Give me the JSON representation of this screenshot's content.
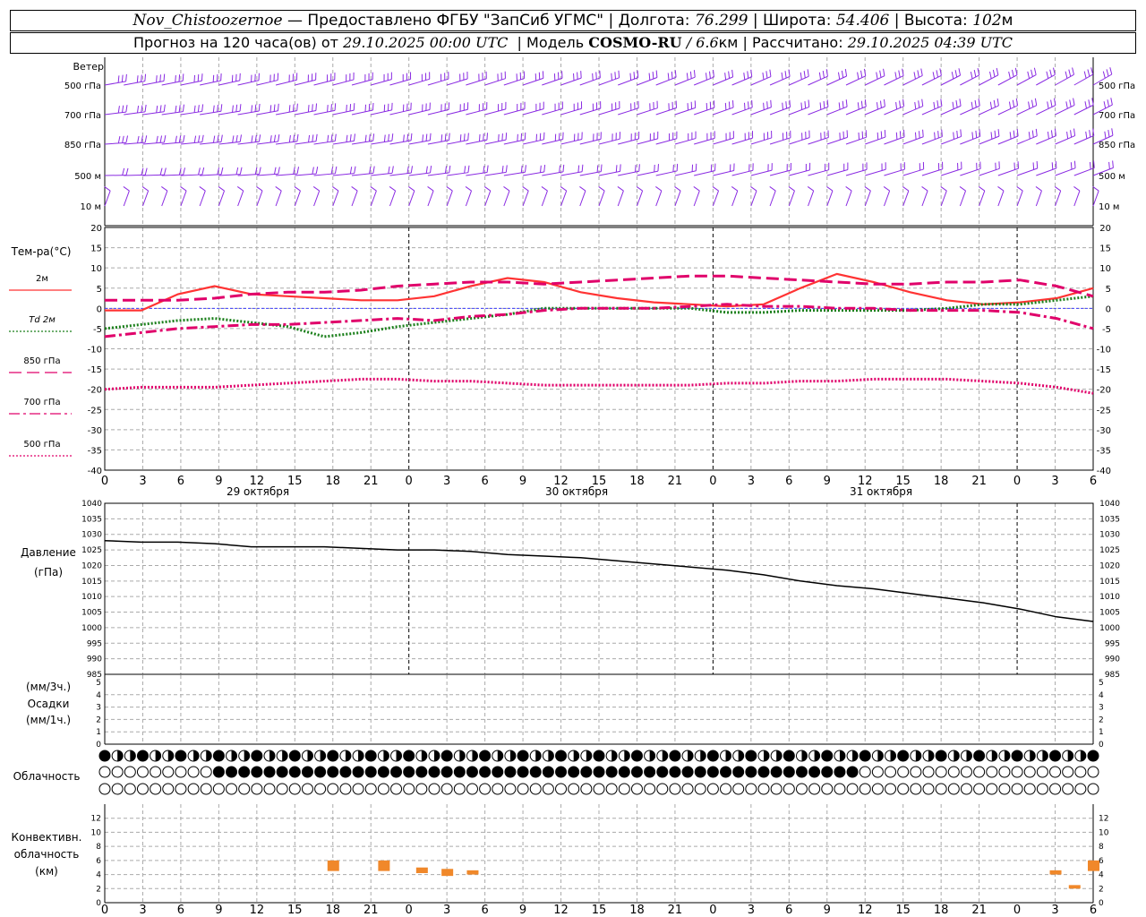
{
  "header": {
    "station": "Nov_Chistoozernoe",
    "provider": "— Предоставлено ФГБУ \"ЗапСиб УГМС\"",
    "lon_label": "Долгота:",
    "lon": "76.299",
    "lat_label": "Широта:",
    "lat": "54.406",
    "alt_label": "Высота:",
    "alt": "102",
    "alt_unit": "м",
    "forecast_label": "Прогноз на 120 часа(ов) от",
    "forecast_from": "29.10.2025 00:00 UTC",
    "model_label": "| Модель",
    "model": "COSMO-RU",
    "resolution": "/ 6.6",
    "res_unit": "км",
    "calc_label": "| Рассчитано:",
    "calc_time": "29.10.2025 04:39 UTC"
  },
  "wind_panel": {
    "title": "Ветер",
    "levels": [
      "500 гПа",
      "700 гПа",
      "850 гПа",
      "500 м",
      "10  м"
    ],
    "color": "#8a2be2"
  },
  "temp_panel": {
    "title": "Тем-ра(°C)",
    "legend": [
      {
        "label": "2м",
        "color": "#ff3333",
        "style": "solid"
      },
      {
        "label": "Td  2м",
        "color": "#1a7f1a",
        "style": "dotted"
      },
      {
        "label": "850 гПа",
        "color": "#e0006a",
        "style": "dashed"
      },
      {
        "label": "700 гПа",
        "color": "#e0006a",
        "style": "dashdot"
      },
      {
        "label": "500 гПа",
        "color": "#e0006a",
        "style": "dotted"
      }
    ],
    "y_ticks": [
      "20",
      "15",
      "10",
      "5",
      "0",
      "-5",
      "-10",
      "-15",
      "-20",
      "-25",
      "-30",
      "-35",
      "-40"
    ],
    "hour_ticks": [
      "0",
      "3",
      "6",
      "9",
      "12",
      "15",
      "18",
      "21",
      "0",
      "3",
      "6",
      "9",
      "12",
      "15",
      "18",
      "21",
      "0",
      "3",
      "6",
      "9",
      "12",
      "15",
      "18",
      "21",
      "0",
      "3",
      "6"
    ],
    "dates": [
      "29 октября",
      "30 октября",
      "31 октября"
    ]
  },
  "pressure_panel": {
    "title": "Давление",
    "unit": "(гПа)",
    "y_ticks": [
      "1040",
      "1035",
      "1030",
      "1025",
      "1020",
      "1015",
      "1010",
      "1005",
      "1000",
      "995",
      "990",
      "985"
    ]
  },
  "precip_panel": {
    "unit_top": "(мм/3ч.)",
    "title": "Осадки",
    "unit_bottom": "(мм/1ч.)",
    "y_ticks": [
      "5",
      "4",
      "3",
      "2",
      "1",
      "0"
    ]
  },
  "cloud_panel": {
    "title": "Облачность"
  },
  "convective_panel": {
    "title_1": "Конвективн.",
    "title_2": "облачность",
    "unit": "(км)",
    "y_ticks": [
      "12",
      "10",
      "8",
      "6",
      "4",
      "2",
      "0"
    ],
    "bottom_ticks": [
      "0",
      "3",
      "6",
      "9",
      "12",
      "15",
      "18",
      "21",
      "0",
      "3",
      "6",
      "9",
      "12",
      "15",
      "18",
      "21",
      "0",
      "3",
      "6",
      "9",
      "12",
      "15",
      "18",
      "21",
      "0",
      "3",
      "6"
    ]
  },
  "chart_data": {
    "type": "line",
    "x_hours": [
      0,
      3,
      6,
      9,
      12,
      15,
      18,
      21,
      24,
      27,
      30,
      33,
      36,
      39,
      42,
      45,
      48,
      51,
      54,
      57,
      60,
      63,
      66,
      69,
      72,
      75,
      78
    ],
    "temperature": {
      "ylim": [
        -40,
        20
      ],
      "series": [
        {
          "name": "2м",
          "values": [
            -0.5,
            -0.5,
            3.5,
            5.5,
            3.5,
            3,
            2.5,
            2,
            2,
            3,
            5.5,
            7.5,
            6.5,
            4,
            2.5,
            1.5,
            1,
            0.5,
            1,
            5,
            8.5,
            6.5,
            4,
            2,
            1,
            1.5,
            2.5,
            5
          ]
        },
        {
          "name": "Td  2м",
          "values": [
            -5,
            -4,
            -3,
            -2.5,
            -3.5,
            -4.5,
            -7,
            -6,
            -4.5,
            -3.5,
            -2.5,
            -1.5,
            0,
            0,
            0,
            0,
            0,
            -1,
            -1,
            -0.5,
            -0.5,
            -0.5,
            -0.5,
            0,
            1,
            1,
            2,
            3
          ]
        },
        {
          "name": "850 гПа",
          "values": [
            2,
            2,
            2,
            2.5,
            3.5,
            4,
            4,
            4.5,
            5.5,
            6,
            6.5,
            6.5,
            6,
            6.5,
            7,
            7.5,
            8,
            8,
            7.5,
            7,
            6.5,
            6,
            6,
            6.5,
            6.5,
            7,
            5.5,
            3
          ]
        },
        {
          "name": "700 гПа",
          "values": [
            -7,
            -6,
            -5,
            -4.5,
            -4,
            -4,
            -3.5,
            -3,
            -2.5,
            -3,
            -2,
            -1.5,
            -0.5,
            0,
            0,
            0,
            0.5,
            1,
            0.5,
            0.5,
            0,
            0,
            -0.5,
            -0.5,
            -0.5,
            -1,
            -2.5,
            -5
          ]
        },
        {
          "name": "500 гПа",
          "values": [
            -20,
            -19.5,
            -19.5,
            -19.5,
            -19,
            -18.5,
            -18,
            -17.5,
            -17.5,
            -18,
            -18,
            -18.5,
            -19,
            -19,
            -19,
            -19,
            -19,
            -18.5,
            -18.5,
            -18,
            -18,
            -17.5,
            -17.5,
            -17.5,
            -18,
            -18.5,
            -19.5,
            -21
          ]
        }
      ]
    },
    "pressure": {
      "ylim": [
        985,
        1040
      ],
      "values": [
        1028,
        1027.5,
        1027.5,
        1027,
        1026,
        1026,
        1026,
        1025.5,
        1025,
        1025,
        1024.5,
        1023.5,
        1023,
        1022.5,
        1021.5,
        1020.5,
        1019.5,
        1018.5,
        1017,
        1015,
        1013.5,
        1012.5,
        1011,
        1009.5,
        1008,
        1006,
        1003.5,
        1002
      ]
    },
    "convective_cloud_km": [
      {
        "hour": 18,
        "base": 4.5,
        "top": 6
      },
      {
        "hour": 22,
        "base": 4.5,
        "top": 6
      },
      {
        "hour": 25,
        "base": 4.2,
        "top": 5
      },
      {
        "hour": 27,
        "base": 3.8,
        "top": 4.8
      },
      {
        "hour": 29,
        "base": 4,
        "top": 4.6
      },
      {
        "hour": 75,
        "base": 4,
        "top": 4.6
      },
      {
        "hour": 76.5,
        "base": 2,
        "top": 2.5
      },
      {
        "hour": 78,
        "base": 4.5,
        "top": 6
      }
    ]
  }
}
